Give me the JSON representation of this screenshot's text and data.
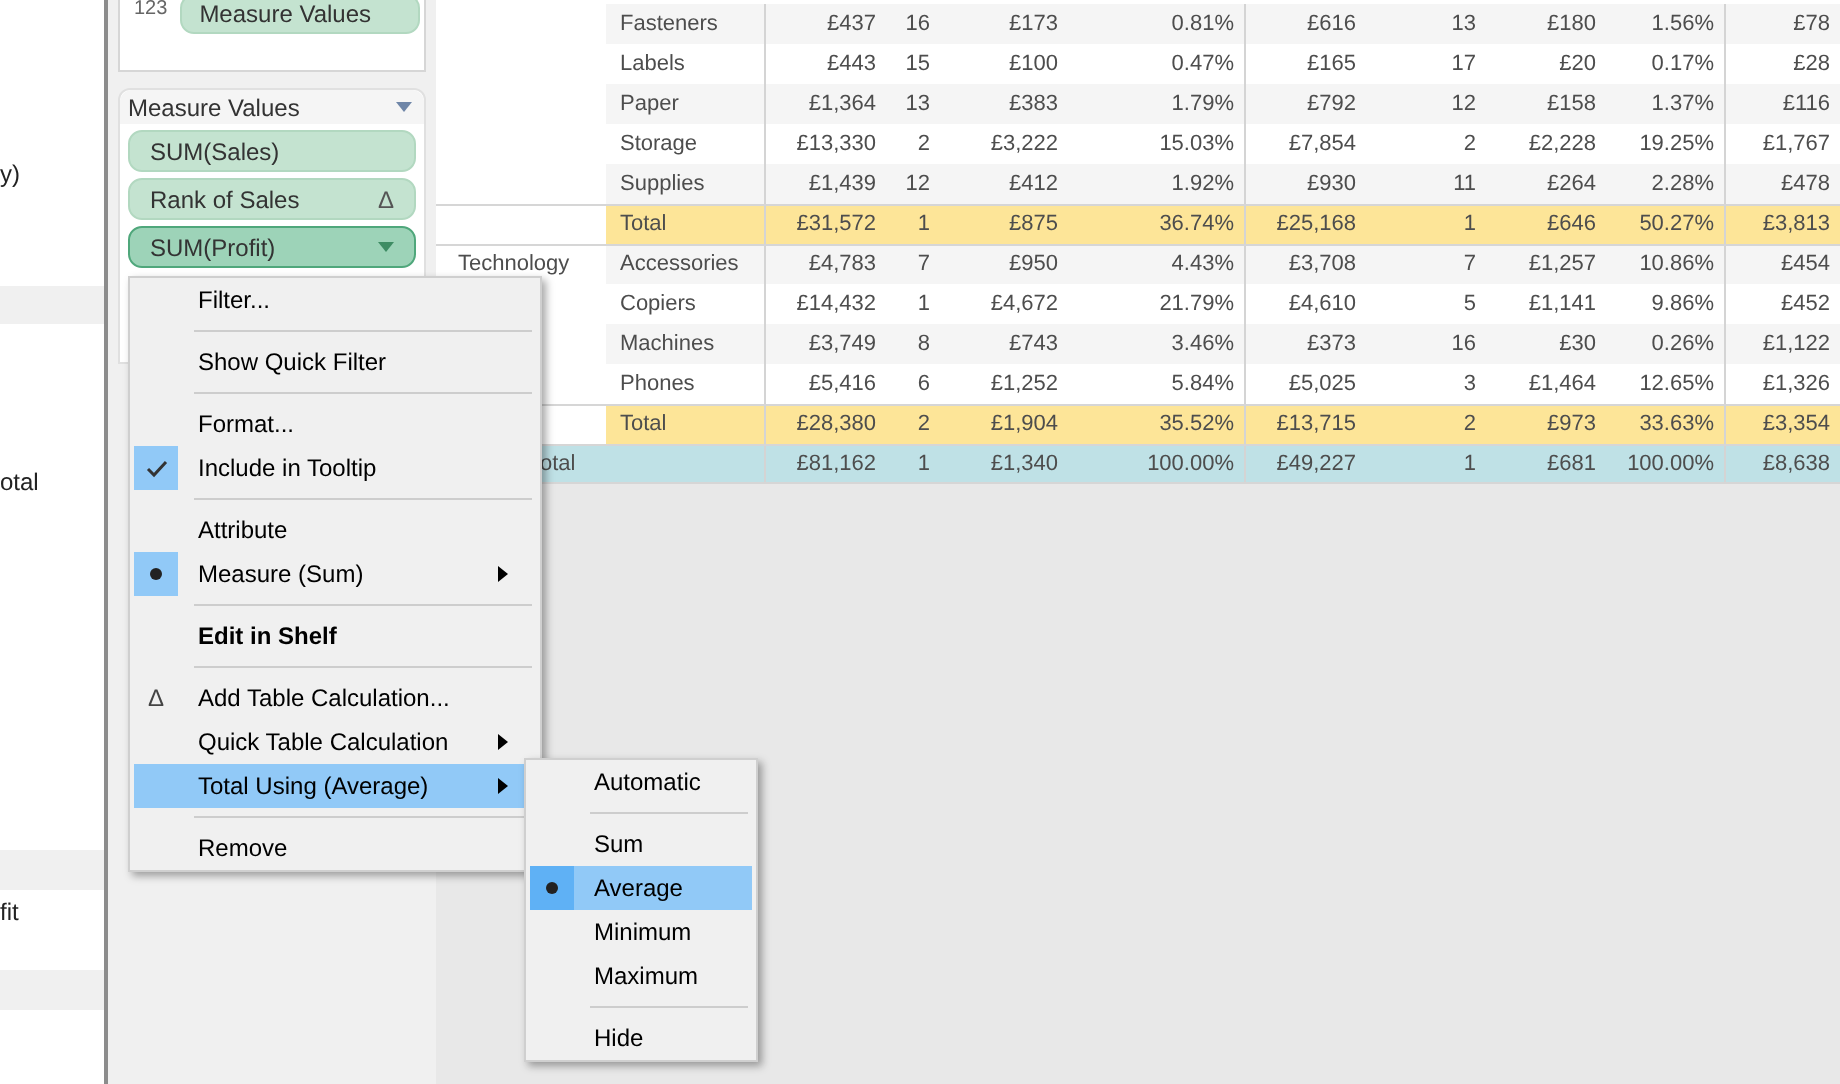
{
  "left_panel": {
    "texts": [
      "y)",
      "otal",
      "fit"
    ]
  },
  "shelf_card": {
    "type_label": "123",
    "pill": "Measure Values"
  },
  "measure_values_card": {
    "title": "Measure Values",
    "pills": [
      {
        "label": "SUM(Sales)",
        "selected": false
      },
      {
        "label": "Rank of Sales",
        "glyph": "Δ",
        "selected": false
      },
      {
        "label": "SUM(Profit)",
        "selected": true
      }
    ]
  },
  "table": {
    "groups": [
      {
        "rows": [
          {
            "label": "Fasteners",
            "values": [
              "£437",
              "16",
              "£173",
              "0.81%",
              "£616",
              "13",
              "£180",
              "1.56%",
              "£78"
            ]
          },
          {
            "label": "Labels",
            "values": [
              "£443",
              "15",
              "£100",
              "0.47%",
              "£165",
              "17",
              "£20",
              "0.17%",
              "£28"
            ]
          },
          {
            "label": "Paper",
            "values": [
              "£1,364",
              "13",
              "£383",
              "1.79%",
              "£792",
              "12",
              "£158",
              "1.37%",
              "£116"
            ]
          },
          {
            "label": "Storage",
            "values": [
              "£13,330",
              "2",
              "£3,222",
              "15.03%",
              "£7,854",
              "2",
              "£2,228",
              "19.25%",
              "£1,767"
            ]
          },
          {
            "label": "Supplies",
            "values": [
              "£1,439",
              "12",
              "£412",
              "1.92%",
              "£930",
              "11",
              "£264",
              "2.28%",
              "£478"
            ]
          }
        ],
        "total": {
          "label": "Total",
          "values": [
            "£31,572",
            "1",
            "£875",
            "36.74%",
            "£25,168",
            "1",
            "£646",
            "50.27%",
            "£3,813"
          ]
        }
      },
      {
        "category": "Technology",
        "rows": [
          {
            "label": "Accessories",
            "values": [
              "£4,783",
              "7",
              "£950",
              "4.43%",
              "£3,708",
              "7",
              "£1,257",
              "10.86%",
              "£454"
            ]
          },
          {
            "label": "Copiers",
            "values": [
              "£14,432",
              "1",
              "£4,672",
              "21.79%",
              "£4,610",
              "5",
              "£1,141",
              "9.86%",
              "£452"
            ]
          },
          {
            "label": "Machines",
            "values": [
              "£3,749",
              "8",
              "£743",
              "3.46%",
              "£373",
              "16",
              "£30",
              "0.26%",
              "£1,122"
            ]
          },
          {
            "label": "Phones",
            "values": [
              "£5,416",
              "6",
              "£1,252",
              "5.84%",
              "£5,025",
              "3",
              "£1,464",
              "12.65%",
              "£1,326"
            ]
          }
        ],
        "total": {
          "label": "Total",
          "values": [
            "£28,380",
            "2",
            "£1,904",
            "35.52%",
            "£13,715",
            "2",
            "£973",
            "33.63%",
            "£3,354"
          ]
        }
      }
    ],
    "grand_total": {
      "label": "otal",
      "values": [
        "£81,162",
        "1",
        "£1,340",
        "100.00%",
        "£49,227",
        "1",
        "£681",
        "100.00%",
        "£8,638"
      ]
    }
  },
  "context_menu": {
    "items": [
      {
        "kind": "item",
        "label": "Filter...",
        "selected": false
      },
      {
        "kind": "separator"
      },
      {
        "kind": "item",
        "label": "Show Quick Filter",
        "selected": false
      },
      {
        "kind": "separator"
      },
      {
        "kind": "item",
        "label": "Format...",
        "selected": false
      },
      {
        "kind": "check_item",
        "label": "Include in Tooltip",
        "checked": true,
        "selected": false
      },
      {
        "kind": "separator"
      },
      {
        "kind": "item",
        "label": "Attribute",
        "selected": false
      },
      {
        "kind": "radio_item",
        "label": "Measure (Sum)",
        "checked": true,
        "submenu": true,
        "selected": false
      },
      {
        "kind": "separator"
      },
      {
        "kind": "item",
        "label": "Edit in Shelf",
        "emphasized": true,
        "selected": false
      },
      {
        "kind": "separator"
      },
      {
        "kind": "item",
        "label": "Add Table Calculation...",
        "glyph": "Δ",
        "selected": false
      },
      {
        "kind": "item",
        "label": "Quick Table Calculation",
        "submenu": true,
        "selected": false
      },
      {
        "kind": "item",
        "label": "Total Using (Average)",
        "submenu": true,
        "selected": true
      },
      {
        "kind": "separator"
      },
      {
        "kind": "item",
        "label": "Remove",
        "selected": false
      }
    ]
  },
  "submenu": {
    "items": [
      {
        "kind": "item",
        "label": "Automatic",
        "selected": false
      },
      {
        "kind": "separator"
      },
      {
        "kind": "item",
        "label": "Sum",
        "selected": false
      },
      {
        "kind": "radio_item",
        "label": "Average",
        "checked": true,
        "selected": true
      },
      {
        "kind": "item",
        "label": "Minimum",
        "selected": false
      },
      {
        "kind": "item",
        "label": "Maximum",
        "selected": false
      },
      {
        "kind": "separator"
      },
      {
        "kind": "item",
        "label": "Hide",
        "selected": false
      }
    ]
  }
}
